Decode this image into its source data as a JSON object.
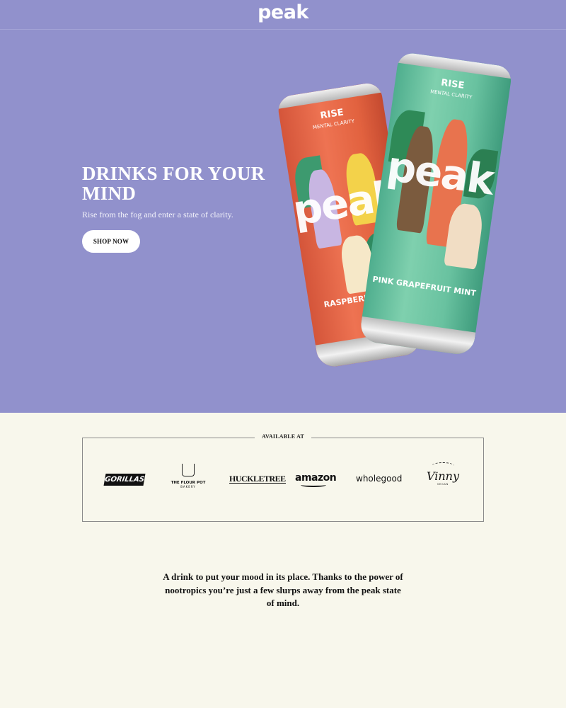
{
  "header": {
    "logo": "peak"
  },
  "hero": {
    "title": "DRINKS FOR YOUR MIND",
    "subtitle": "Rise from the fog and enter a state of clarity.",
    "cta_label": "SHOP NOW",
    "background_color": "#9191cc",
    "cans": [
      {
        "line": "RISE",
        "tagline": "MENTAL CLARITY",
        "brand": "peak",
        "flavor": "RASPBERRY LIME",
        "color": "#ee7352"
      },
      {
        "line": "RISE",
        "tagline": "MENTAL CLARITY",
        "brand": "peak",
        "flavor": "PINK GRAPEFRUIT MINT",
        "color": "#7fd0ae"
      }
    ]
  },
  "available": {
    "title": "AVAILABLE AT",
    "retailers": [
      {
        "name": "GORILLAS"
      },
      {
        "name": "THE FLOUR POT",
        "sub": "BAKERY"
      },
      {
        "name": "HUCKLETREE"
      },
      {
        "name": "amazon"
      },
      {
        "name": "wholegood"
      },
      {
        "name": "Vinny",
        "sub": "VEGAN"
      }
    ]
  },
  "intro": {
    "text": "A drink to put your mood in its place. Thanks to the power of nootropics you’re just a few slurps away from the peak state of mind."
  }
}
